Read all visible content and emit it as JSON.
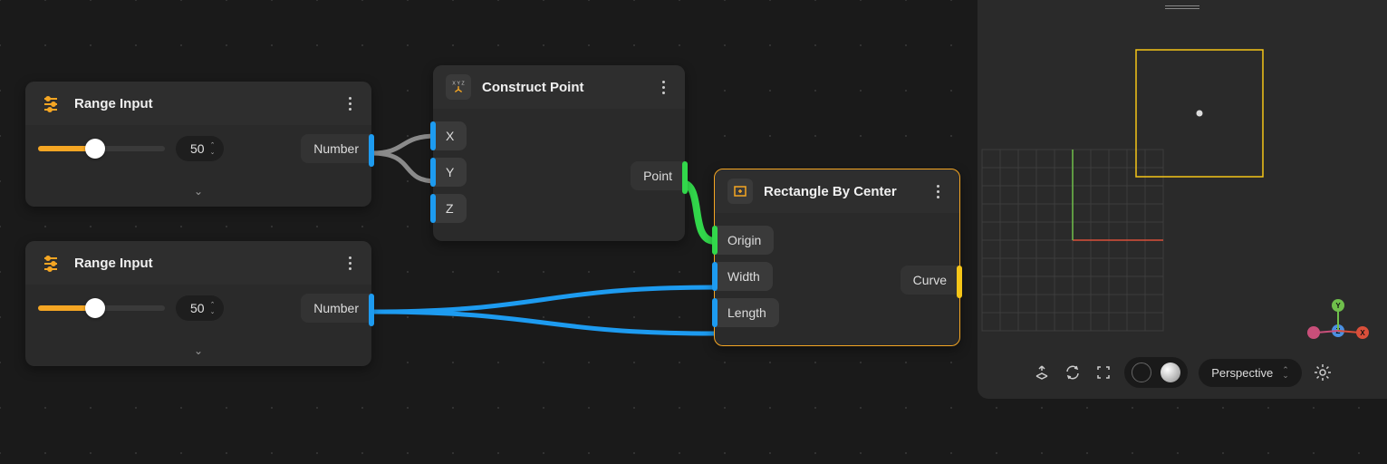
{
  "nodes": {
    "range1": {
      "title": "Range Input",
      "value": "50",
      "output": "Number",
      "slider_pct": 45
    },
    "range2": {
      "title": "Range Input",
      "value": "50",
      "output": "Number",
      "slider_pct": 45
    },
    "construct": {
      "title": "Construct Point",
      "inputs": {
        "x": "X",
        "y": "Y",
        "z": "Z"
      },
      "output": "Point"
    },
    "rect": {
      "title": "Rectangle By Center",
      "inputs": {
        "origin": "Origin",
        "width": "Width",
        "length": "Length"
      },
      "output": "Curve"
    }
  },
  "viewport": {
    "mode": "Perspective",
    "axes": {
      "x": "X",
      "y": "Y",
      "z": "Z"
    }
  },
  "colors": {
    "accent": "#f5a623",
    "blue": "#1d9bf0",
    "green": "#32d74b",
    "yellow": "#f5c518",
    "grey_wire": "#8a8a8a"
  }
}
